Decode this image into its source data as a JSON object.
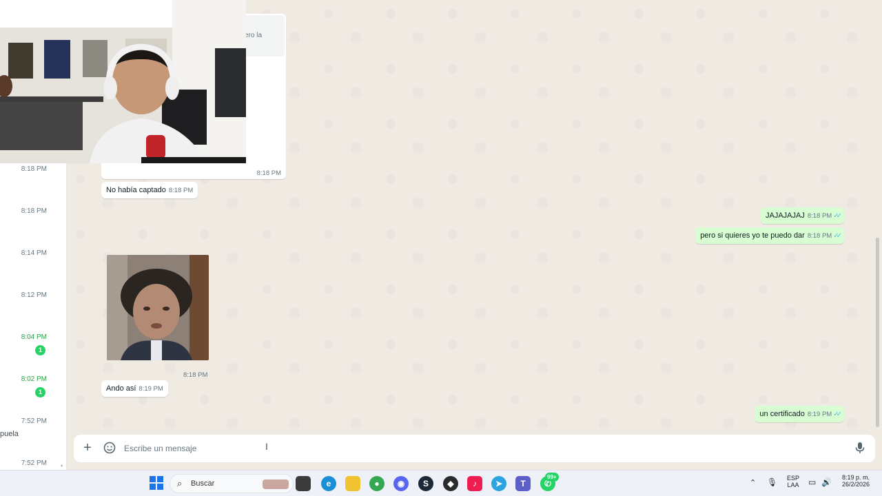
{
  "chat_list": {
    "times": [
      "8:18 PM",
      "8:18 PM",
      "8:14 PM",
      "8:12 PM",
      "8:04 PM",
      "8:02 PM",
      "7:52 PM",
      "7:52 PM"
    ],
    "badges": [
      "1",
      "1"
    ],
    "snippet_fragment": "puela"
  },
  "conversation": {
    "truncated_reply_fragment": "ero la",
    "messages": [
      {
        "dir": "in",
        "text": "",
        "time": "8:18 PM"
      },
      {
        "dir": "in",
        "text": "No había captado",
        "time": "8:18 PM"
      },
      {
        "dir": "out",
        "text": "JAJAJAJAJ",
        "time": "8:18 PM",
        "status": "read"
      },
      {
        "dir": "out",
        "text": "pero si quieres yo te puedo dar",
        "time": "8:18 PM",
        "status": "read"
      },
      {
        "dir": "in",
        "text": "",
        "time": "8:18 PM",
        "kind": "image"
      },
      {
        "dir": "in",
        "text": "Ando así",
        "time": "8:19 PM"
      },
      {
        "dir": "out",
        "text": "un certificado",
        "time": "8:19 PM",
        "status": "read"
      }
    ]
  },
  "composer": {
    "placeholder": "Escribe un mensaje",
    "attach_icon": "plus-icon",
    "emoji_icon": "sticker-icon",
    "mic_icon": "microphone-icon"
  },
  "taskbar": {
    "search_label": "Buscar",
    "whatsapp_badge": "99+",
    "language": "ESP",
    "language_sub": "LAA",
    "time": "8:19 p. m.",
    "date": "26/2/2026"
  },
  "colors": {
    "incoming_bubble": "#ffffff",
    "outgoing_bubble": "#d9fdd3",
    "read_ticks": "#53bdeb",
    "unread_accent": "#25d366",
    "chat_background": "#efeae2"
  }
}
